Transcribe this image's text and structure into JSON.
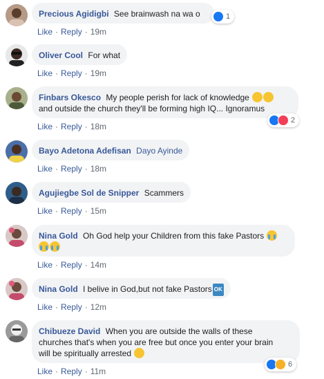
{
  "actions": {
    "like": "Like",
    "reply": "Reply",
    "dot": "·"
  },
  "comments": [
    {
      "author": "Precious Agidigbi",
      "text": "See brainwash na wa o",
      "time": "19m",
      "reaction_count": "1"
    },
    {
      "author": "Oliver Cool",
      "text": "For what",
      "time": "19m"
    },
    {
      "author": "Finbars Okesco",
      "text": "My people perish for lack of knowledge",
      "text2": "and outside the church they'll be forming high IQ... Ignoramus",
      "time": "18m",
      "reaction_count": "2"
    },
    {
      "author": "Bayo Adetona Adefisan",
      "text": "Dayo Ayinde",
      "time": "18m"
    },
    {
      "author": "Agujiegbe Sol de Snipper",
      "text": "Scammers",
      "time": "15m"
    },
    {
      "author": "Nina Gold",
      "text": "Oh God help your Children from this fake Pastors",
      "time": "14m"
    },
    {
      "author": "Nina Gold",
      "text": "I belive in God,but not fake Pastors",
      "ok_badge": "OK",
      "time": "12m"
    },
    {
      "author": "Chibueze David",
      "text": "When you are outside the walls of these",
      "text2": "churches that's when you are free but once you enter your brain",
      "text3": "will be spiritually arrested",
      "time": "11m",
      "reaction_count": "6"
    }
  ],
  "colors": {
    "link": "#385898",
    "bubble": "#f2f3f5",
    "meta": "#606770"
  }
}
